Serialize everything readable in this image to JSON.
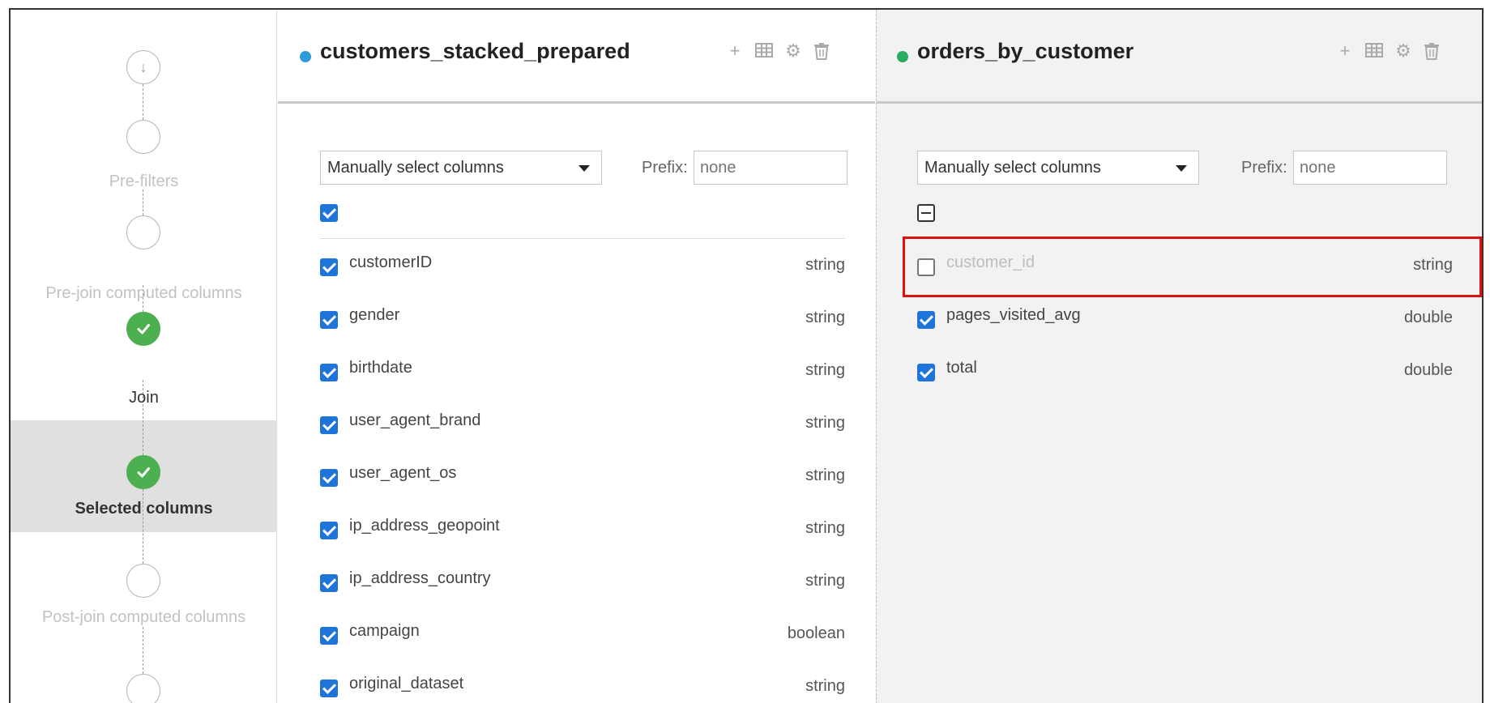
{
  "steps": [
    {
      "label": "",
      "state": "pending",
      "icon": "arrow-down-icon"
    },
    {
      "label": "Pre-filters",
      "state": "pending"
    },
    {
      "label": "Pre-join computed columns",
      "state": "pending"
    },
    {
      "label": "Join",
      "state": "done"
    },
    {
      "label": "Selected columns",
      "state": "done-active"
    },
    {
      "label": "Post-join computed columns",
      "state": "pending"
    },
    {
      "label": "",
      "state": "pending"
    }
  ],
  "left_panel": {
    "title": "customers_stacked_prepared",
    "dot_color": "#2d9cdb",
    "mode": "Manually select columns",
    "prefix_label": "Prefix:",
    "prefix_placeholder": "none",
    "columns": [
      {
        "name": "customerID",
        "type": "string",
        "checked": true
      },
      {
        "name": "gender",
        "type": "string",
        "checked": true
      },
      {
        "name": "birthdate",
        "type": "string",
        "checked": true
      },
      {
        "name": "user_agent_brand",
        "type": "string",
        "checked": true
      },
      {
        "name": "user_agent_os",
        "type": "string",
        "checked": true
      },
      {
        "name": "ip_address_geopoint",
        "type": "string",
        "checked": true
      },
      {
        "name": "ip_address_country",
        "type": "string",
        "checked": true
      },
      {
        "name": "campaign",
        "type": "boolean",
        "checked": true
      },
      {
        "name": "original_dataset",
        "type": "string",
        "checked": true
      }
    ]
  },
  "right_panel": {
    "title": "orders_by_customer",
    "dot_color": "#27ae60",
    "mode": "Manually select columns",
    "prefix_label": "Prefix:",
    "prefix_placeholder": "none",
    "columns": [
      {
        "name": "customer_id",
        "type": "string",
        "checked": false
      },
      {
        "name": "pages_visited_avg",
        "type": "double",
        "checked": true
      },
      {
        "name": "total",
        "type": "double",
        "checked": true
      }
    ]
  },
  "toolbar_icons": [
    "plus-icon",
    "table-icon",
    "gear-icon",
    "trash-icon"
  ]
}
